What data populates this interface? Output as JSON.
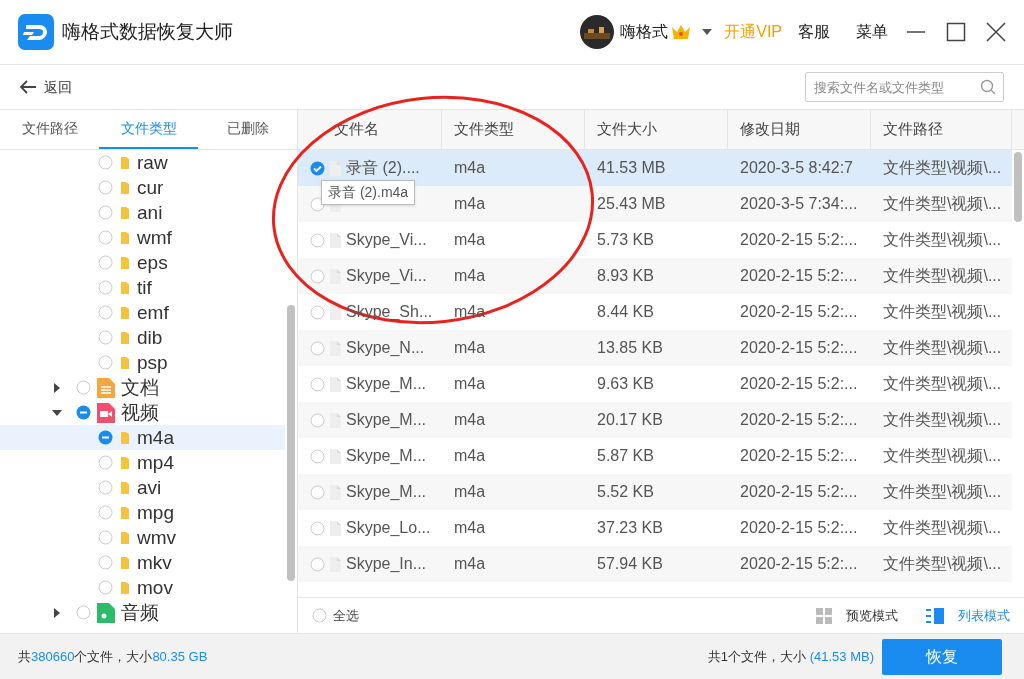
{
  "window": {
    "title": "嗨格式数据恢复大师",
    "user": "嗨格式",
    "vip": "开通VIP",
    "service": "客服",
    "menu": "菜单"
  },
  "toolbar": {
    "back": "返回",
    "search": {
      "placeholder": "搜索文件名或文件类型"
    }
  },
  "tabs": [
    {
      "label": "文件路径",
      "selected": false
    },
    {
      "label": "文件类型",
      "selected": true
    },
    {
      "label": "已删除",
      "selected": false
    }
  ],
  "tree": {
    "partial_children": [
      {
        "label": "raw",
        "partial": false
      },
      {
        "label": "cur",
        "partial": false
      },
      {
        "label": "ani",
        "partial": false
      },
      {
        "label": "wmf",
        "partial": false
      },
      {
        "label": "eps",
        "partial": false
      },
      {
        "label": "tif",
        "partial": false
      },
      {
        "label": "emf",
        "partial": false
      },
      {
        "label": "dib",
        "partial": false
      },
      {
        "label": "psp",
        "partial": false
      }
    ],
    "items": [
      {
        "label": "文档",
        "kind": "document",
        "partial": false,
        "expanded": false
      },
      {
        "label": "视频",
        "kind": "video",
        "partial": true,
        "expanded": true,
        "children": [
          {
            "label": "m4a",
            "partial": true,
            "selected": true
          },
          {
            "label": "mp4",
            "partial": false,
            "selected": false
          },
          {
            "label": "avi",
            "partial": false,
            "selected": false
          },
          {
            "label": "mpg",
            "partial": false,
            "selected": false
          },
          {
            "label": "wmv",
            "partial": false,
            "selected": false
          },
          {
            "label": "mkv",
            "partial": false,
            "selected": false
          },
          {
            "label": "mov",
            "partial": false,
            "selected": false
          }
        ]
      },
      {
        "label": "音频",
        "kind": "audio",
        "partial": false,
        "expanded": false
      }
    ]
  },
  "table": {
    "columns": [
      "文件名",
      "文件类型",
      "文件大小",
      "修改日期",
      "文件路径"
    ],
    "rows": [
      {
        "checked": true,
        "selected": true,
        "cells": [
          "录音 (2)....",
          "m4a",
          "41.53 MB",
          "2020-3-5 8:42:7",
          "文件类型\\视频\\..."
        ]
      },
      {
        "checked": false,
        "selected": false,
        "cells": [
          "",
          "m4a",
          "25.43 MB",
          "2020-3-5 7:34:...",
          "文件类型\\视频\\..."
        ]
      },
      {
        "checked": false,
        "selected": false,
        "cells": [
          "Skype_Vi...",
          "m4a",
          "5.73 KB",
          "2020-2-15 5:2:...",
          "文件类型\\视频\\..."
        ]
      },
      {
        "checked": false,
        "selected": false,
        "cells": [
          "Skype_Vi...",
          "m4a",
          "8.93 KB",
          "2020-2-15 5:2:...",
          "文件类型\\视频\\..."
        ]
      },
      {
        "checked": false,
        "selected": false,
        "cells": [
          "Skype_Sh...",
          "m4a",
          "8.44 KB",
          "2020-2-15 5:2:...",
          "文件类型\\视频\\..."
        ]
      },
      {
        "checked": false,
        "selected": false,
        "cells": [
          "Skype_N...",
          "m4a",
          "13.85 KB",
          "2020-2-15 5:2:...",
          "文件类型\\视频\\..."
        ]
      },
      {
        "checked": false,
        "selected": false,
        "cells": [
          "Skype_M...",
          "m4a",
          "9.63 KB",
          "2020-2-15 5:2:...",
          "文件类型\\视频\\..."
        ]
      },
      {
        "checked": false,
        "selected": false,
        "cells": [
          "Skype_M...",
          "m4a",
          "20.17 KB",
          "2020-2-15 5:2:...",
          "文件类型\\视频\\..."
        ]
      },
      {
        "checked": false,
        "selected": false,
        "cells": [
          "Skype_M...",
          "m4a",
          "5.87 KB",
          "2020-2-15 5:2:...",
          "文件类型\\视频\\..."
        ]
      },
      {
        "checked": false,
        "selected": false,
        "cells": [
          "Skype_M...",
          "m4a",
          "5.52 KB",
          "2020-2-15 5:2:...",
          "文件类型\\视频\\..."
        ]
      },
      {
        "checked": false,
        "selected": false,
        "cells": [
          "Skype_Lo...",
          "m4a",
          "37.23 KB",
          "2020-2-15 5:2:...",
          "文件类型\\视频\\..."
        ]
      },
      {
        "checked": false,
        "selected": false,
        "cells": [
          "Skype_In...",
          "m4a",
          "57.94 KB",
          "2020-2-15 5:2:...",
          "文件类型\\视频\\..."
        ]
      }
    ],
    "tooltip": "录音 (2).m4a"
  },
  "list_footer": {
    "select_all": {
      "label": "全选",
      "checked": false
    },
    "modes": [
      {
        "label": "预览模式",
        "kind": "grid",
        "selected": false
      },
      {
        "label": "列表模式",
        "kind": "list",
        "selected": true
      }
    ]
  },
  "status_bar": {
    "total": "共**380660**个文件，大小**80.35 GB**",
    "selection": "共1个文件，大小 **(41.53 MB)**",
    "recover": "恢复"
  }
}
